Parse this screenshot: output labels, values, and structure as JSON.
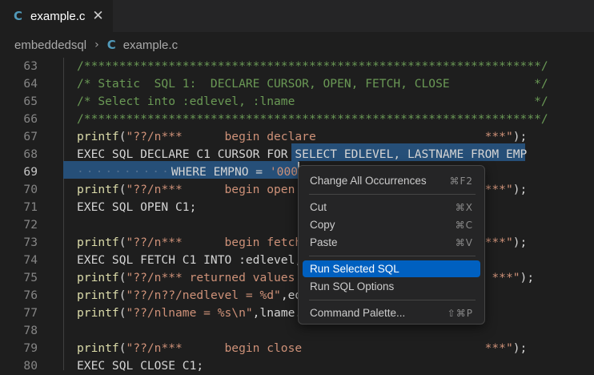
{
  "tab": {
    "icon": "c-file-icon",
    "icon_glyph": "C",
    "label": "example.c",
    "close_glyph": "✕"
  },
  "breadcrumb": {
    "folder": "embeddedsql",
    "separator": "›",
    "icon_glyph": "C",
    "file": "example.c"
  },
  "editor": {
    "current_line": 69,
    "lines": [
      {
        "n": "63",
        "tokens": [
          [
            "comment",
            "/*****************************************************************/"
          ]
        ]
      },
      {
        "n": "64",
        "tokens": [
          [
            "comment",
            "/* Static  SQL 1:  DECLARE CURSOR, OPEN, FETCH, CLOSE            */"
          ]
        ]
      },
      {
        "n": "65",
        "tokens": [
          [
            "comment",
            "/* Select into :edlevel, :lname                                  */"
          ]
        ]
      },
      {
        "n": "66",
        "tokens": [
          [
            "comment",
            "/*****************************************************************/"
          ]
        ]
      },
      {
        "n": "67",
        "tokens": [
          [
            "fn",
            "printf"
          ],
          [
            "plain",
            "("
          ],
          [
            "str",
            "\"??/n***      begin declare                        ***\""
          ],
          [
            "plain",
            ");"
          ]
        ]
      },
      {
        "n": "68",
        "tokens": [
          [
            "plain",
            "EXEC SQL DECLARE C1 CURSOR FOR SELECT EDLEVEL, LASTNAME FROM EMP"
          ]
        ]
      },
      {
        "n": "69",
        "tokens": [
          [
            "dots",
            "··········"
          ],
          [
            "plain",
            "WHERE EMPNO = "
          ],
          [
            "str",
            "'000010'"
          ],
          [
            "plain",
            ";"
          ]
        ]
      },
      {
        "n": "70",
        "tokens": [
          [
            "fn",
            "printf"
          ],
          [
            "plain",
            "("
          ],
          [
            "str",
            "\"??/n***      begin open                           ***\""
          ],
          [
            "plain",
            ");"
          ]
        ]
      },
      {
        "n": "71",
        "tokens": [
          [
            "plain",
            "EXEC SQL OPEN C1;"
          ]
        ]
      },
      {
        "n": "72",
        "tokens": []
      },
      {
        "n": "73",
        "tokens": [
          [
            "fn",
            "printf"
          ],
          [
            "plain",
            "("
          ],
          [
            "str",
            "\"??/n***      begin fetch                          ***\""
          ],
          [
            "plain",
            ");"
          ]
        ]
      },
      {
        "n": "74",
        "tokens": [
          [
            "plain",
            "EXEC SQL FETCH C1 INTO :edlevel, :lname;"
          ]
        ]
      },
      {
        "n": "75",
        "tokens": [
          [
            "fn",
            "printf"
          ],
          [
            "plain",
            "("
          ],
          [
            "str",
            "\"??/n*** returned values                            ***\""
          ],
          [
            "plain",
            ");"
          ]
        ]
      },
      {
        "n": "76",
        "tokens": [
          [
            "fn",
            "printf"
          ],
          [
            "plain",
            "("
          ],
          [
            "str",
            "\"??/n??/nedlevel = %d\""
          ],
          [
            "plain",
            ",edlevel);"
          ]
        ]
      },
      {
        "n": "77",
        "tokens": [
          [
            "fn",
            "printf"
          ],
          [
            "plain",
            "("
          ],
          [
            "str",
            "\"??/nlname = %s\\n\""
          ],
          [
            "plain",
            ",lname.data);"
          ]
        ]
      },
      {
        "n": "78",
        "tokens": []
      },
      {
        "n": "79",
        "tokens": [
          [
            "fn",
            "printf"
          ],
          [
            "plain",
            "("
          ],
          [
            "str",
            "\"??/n***      begin close                          ***\""
          ],
          [
            "plain",
            ");"
          ]
        ]
      },
      {
        "n": "80",
        "tokens": [
          [
            "plain",
            "EXEC SQL CLOSE C1;"
          ]
        ]
      }
    ]
  },
  "context_menu": {
    "items": [
      {
        "label": "Change All Occurrences",
        "shortcut": "⌘F2",
        "name": "menu-item-change-all-occurrences"
      },
      {
        "label": "Cut",
        "shortcut": "⌘X",
        "name": "menu-item-cut"
      },
      {
        "label": "Copy",
        "shortcut": "⌘C",
        "name": "menu-item-copy"
      },
      {
        "label": "Paste",
        "shortcut": "⌘V",
        "name": "menu-item-paste"
      },
      {
        "label": "Run Selected SQL",
        "shortcut": "",
        "name": "menu-item-run-selected-sql",
        "active": true
      },
      {
        "label": "Run SQL Options",
        "shortcut": "",
        "name": "menu-item-run-sql-options"
      },
      {
        "label": "Command Palette...",
        "shortcut": "⇧⌘P",
        "name": "menu-item-command-palette"
      }
    ]
  },
  "colors": {
    "background": "#1e1e1e",
    "selection": "#264f78",
    "menu_highlight": "#0060c0",
    "comment": "#6a9955",
    "string": "#ce9178",
    "function": "#dcdcaa"
  }
}
